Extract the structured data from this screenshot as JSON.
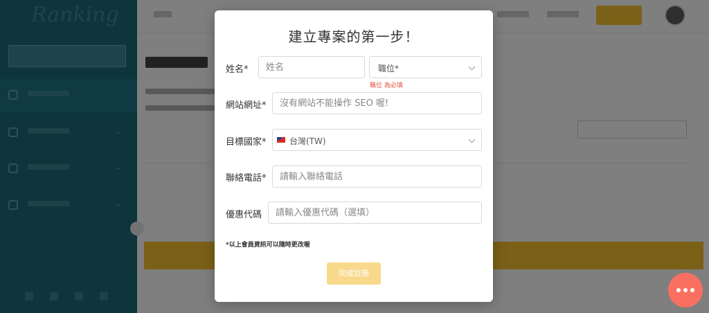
{
  "app": {
    "logo": "Ranking"
  },
  "modal": {
    "title": "建立專案的第一步！",
    "name": {
      "label": "姓名*",
      "placeholder": "姓名"
    },
    "position": {
      "selected": "職位*",
      "error": "職位 為必填"
    },
    "website": {
      "label": "網站網址*",
      "placeholder": "沒有網站不能操作 SEO 喔!"
    },
    "country": {
      "label": "目標國家*",
      "selected": "台灣(TW)",
      "flag": "tw-flag-icon"
    },
    "phone": {
      "label": "聯絡電話*",
      "placeholder": "請輸入聯絡電話"
    },
    "promo": {
      "label": "優惠代碼",
      "placeholder": "請輸入優惠代碼（選填）"
    },
    "note": "*以上會員資訊可以隨時更改喔",
    "submit_label": "完成註冊"
  },
  "colors": {
    "accent": "#f6c02f",
    "sidebar": "#1c6a78",
    "error": "#e2533b",
    "chat": "#fa7060",
    "submit_disabled": "#f8d98c"
  }
}
